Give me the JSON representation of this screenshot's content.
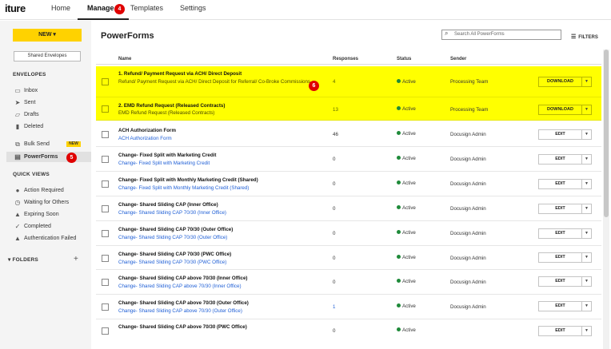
{
  "app": {
    "logo": "iture"
  },
  "nav": {
    "tabs": [
      "Home",
      "Manage",
      "Templates",
      "Settings"
    ],
    "active": "Manage"
  },
  "annotations": {
    "manage": "4",
    "powerforms": "5",
    "row": "6"
  },
  "sidebar": {
    "new_label": "NEW ▾",
    "shared_label": "Shared Envelopes",
    "envelopes_heading": "ENVELOPES",
    "envelopes": [
      {
        "label": "Inbox",
        "icon": "inbox-icon"
      },
      {
        "label": "Sent",
        "icon": "send-icon"
      },
      {
        "label": "Drafts",
        "icon": "draft-icon"
      },
      {
        "label": "Deleted",
        "icon": "trash-icon"
      }
    ],
    "bulk_send": {
      "label": "Bulk Send",
      "tag": "NEW",
      "icon": "bulk-send-icon"
    },
    "powerforms": {
      "label": "PowerForms",
      "icon": "powerforms-icon"
    },
    "quick_views_heading": "QUICK VIEWS",
    "quick_views": [
      {
        "label": "Action Required",
        "icon": "alert-circle-icon"
      },
      {
        "label": "Waiting for Others",
        "icon": "clock-icon"
      },
      {
        "label": "Expiring Soon",
        "icon": "warning-icon"
      },
      {
        "label": "Completed",
        "icon": "check-icon"
      },
      {
        "label": "Authentication Failed",
        "icon": "warning-icon"
      }
    ],
    "folders_heading": "FOLDERS"
  },
  "main": {
    "title": "PowerForms",
    "search_placeholder": "Search All PowerForms",
    "filters_label": "FILTERS",
    "columns": {
      "name": "Name",
      "responses": "Responses",
      "status": "Status",
      "sender": "Sender"
    }
  },
  "rows": [
    {
      "name": "1. Refund/ Payment Request via ACH/ Direct Deposit",
      "desc": "Refund/ Payment Request via ACH/ Direct Deposit for Referral/ Co-Broke Commissions",
      "responses": "4",
      "status": "Active",
      "sender": "Processing Team",
      "action": "DOWNLOAD",
      "highlight": true
    },
    {
      "name": "2. EMD Refund Request (Released Contracts)",
      "desc": "EMD Refund Request (Released Contracts)",
      "responses": "13",
      "status": "Active",
      "sender": "Processing Team",
      "action": "DOWNLOAD",
      "highlight": true
    },
    {
      "name": "ACH Authorization Form",
      "desc": "ACH Authorization Form",
      "responses": "46",
      "status": "Active",
      "sender": "Docusign Admin",
      "action": "EDIT",
      "highlight": false
    },
    {
      "name": "Change- Fixed Split with Marketing Credit",
      "desc": "Change- Fixed Split with Marketing Credit",
      "responses": "0",
      "status": "Active",
      "sender": "Docusign Admin",
      "action": "EDIT",
      "highlight": false
    },
    {
      "name": "Change- Fixed Split with Monthly Marketing Credit (Shared)",
      "desc": "Change- Fixed Split with Monthly Marketing Credit (Shared)",
      "responses": "0",
      "status": "Active",
      "sender": "Docusign Admin",
      "action": "EDIT",
      "highlight": false
    },
    {
      "name": "Change- Shared Sliding CAP (Inner Office)",
      "desc": "Change- Shared Sliding CAP 70/30 (Inner Office)",
      "responses": "0",
      "status": "Active",
      "sender": "Docusign Admin",
      "action": "EDIT",
      "highlight": false
    },
    {
      "name": "Change- Shared Sliding CAP 70/30 (Outer Office)",
      "desc": "Change- Shared Sliding CAP 70/30 (Outer Office)",
      "responses": "0",
      "status": "Active",
      "sender": "Docusign Admin",
      "action": "EDIT",
      "highlight": false
    },
    {
      "name": "Change- Shared Sliding CAP 70/30 (PWC Office)",
      "desc": "Change- Shared Sliding CAP 70/30 (PWC Office)",
      "responses": "0",
      "status": "Active",
      "sender": "Docusign Admin",
      "action": "EDIT",
      "highlight": false
    },
    {
      "name": "Change- Shared Sliding CAP above 70/30 (Inner Office)",
      "desc": "Change- Shared Sliding CAP above 70/30 (Inner Office)",
      "responses": "0",
      "status": "Active",
      "sender": "Docusign Admin",
      "action": "EDIT",
      "highlight": false
    },
    {
      "name": "Change- Shared Sliding CAP above 70/30 (Outer Office)",
      "desc": "Change- Shared Sliding CAP above 70/30 (Outer Office)",
      "responses": "1",
      "status": "Active",
      "sender": "Docusign Admin",
      "action": "EDIT",
      "highlight": false
    },
    {
      "name": "Change- Shared Sliding CAP above 70/30 (PWC Office)",
      "desc": "",
      "responses": "0",
      "status": "Active",
      "sender": "",
      "action": "EDIT",
      "highlight": false
    }
  ]
}
